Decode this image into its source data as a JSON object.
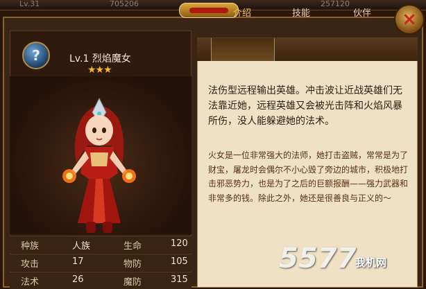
{
  "topbar": {
    "level": "Lv.31",
    "num_left": "705206",
    "num_right": "257120"
  },
  "hero": {
    "class_icon_glyph": "?",
    "name": "Lv.1 烈焰魔女",
    "stars": "★★★",
    "star_count": 3
  },
  "tabs": [
    {
      "label": "介绍"
    },
    {
      "label": "技能"
    },
    {
      "label": "伙伴"
    }
  ],
  "intro": "法伤型远程输出英雄。冲击波让近战英雄们无法靠近她，远程英雄又会被光击阵和火焰风暴所伤，没人能躲避她的法术。",
  "story": "火女是一位非常强大的法师，她打击盗贼，常常是为了财宝，屠龙时会偶尔不小心毁了旁边的城市，积极地打击邪恶势力，也是为了之后的巨额报酬——强力武器和非常多的钱。除此之外，她还是很善良与正义的～",
  "stats": [
    {
      "k1": "种族",
      "v1": "人族",
      "k2": "生命",
      "v2": "120"
    },
    {
      "k1": "攻击",
      "v1": "17",
      "k2": "物防",
      "v2": "105"
    },
    {
      "k1": "法术",
      "v1": "26",
      "k2": "魔防",
      "v2": "315"
    }
  ],
  "watermark": {
    "logo": "5577",
    "site": "我机网"
  },
  "close_icon": "×",
  "colors": {
    "accent": "#f6c85a",
    "panel": "#efe2c4",
    "story_text": "#5b2f12"
  }
}
